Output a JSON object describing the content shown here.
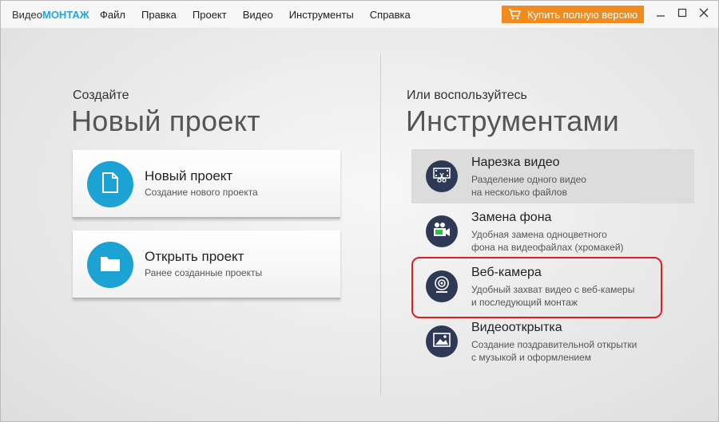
{
  "app": {
    "brand_part1": "Видео",
    "brand_part2": "МОНТАЖ",
    "menu": [
      "Файл",
      "Правка",
      "Проект",
      "Видео",
      "Инструменты",
      "Справка"
    ],
    "buy_label": "Купить полную версию"
  },
  "left": {
    "subtitle": "Создайте",
    "title": "Новый проект",
    "cards": [
      {
        "title": "Новый проект",
        "desc": "Создание нового проекта",
        "icon": "file-icon"
      },
      {
        "title": "Открыть проект",
        "desc": "Ранее созданные проекты",
        "icon": "folder-icon"
      }
    ]
  },
  "right": {
    "subtitle": "Или воспользуйтесь",
    "title": "Инструментами",
    "tools": [
      {
        "title": "Нарезка видео",
        "desc": "Разделение одного видео\nна несколько файлов",
        "icon": "film-cut-icon"
      },
      {
        "title": "Замена фона",
        "desc": "Удобная замена одноцветного\nфона на видеофайлах (хромакей)",
        "icon": "chromakey-camera-icon"
      },
      {
        "title": "Веб-камера",
        "desc": "Удобный захват видео с веб-камеры\nи последующий монтаж",
        "icon": "webcam-icon"
      },
      {
        "title": "Видеооткрытка",
        "desc": "Создание поздравительной открытки\nс музыкой и оформлением",
        "icon": "postcard-image-icon"
      }
    ]
  },
  "colors": {
    "accent_blue": "#1ca2d3",
    "buy_orange": "#f08c1f",
    "tool_circle": "#2e3a55",
    "highlight_red": "#e11d1d"
  }
}
